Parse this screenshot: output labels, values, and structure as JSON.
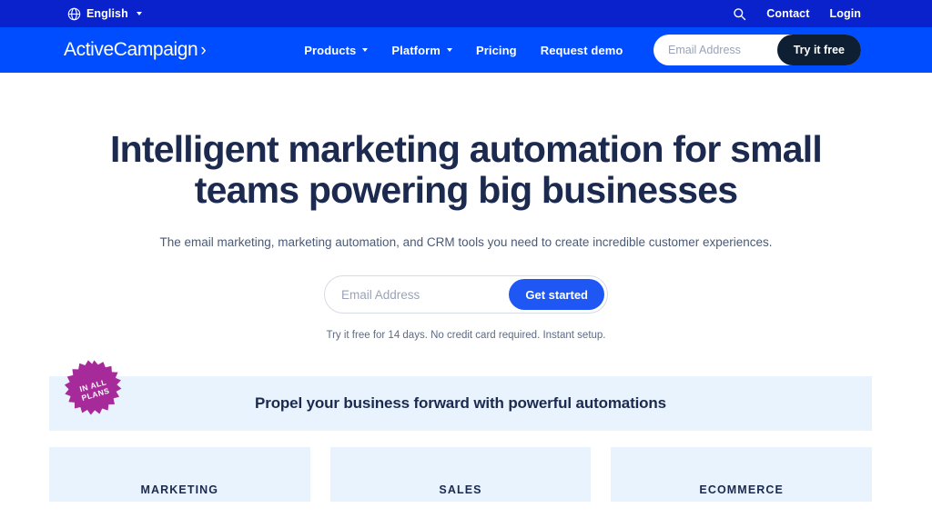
{
  "topbar": {
    "language": "English",
    "globe_icon": "globe-icon",
    "caret_icon": "chevron-down-icon",
    "search_icon": "search-icon",
    "links": [
      {
        "label": "Contact"
      },
      {
        "label": "Login"
      }
    ]
  },
  "navbar": {
    "logo_text": "ActiveCampaign",
    "logo_chevron": "›",
    "links": [
      {
        "label": "Products",
        "has_caret": true
      },
      {
        "label": "Platform",
        "has_caret": true
      },
      {
        "label": "Pricing",
        "has_caret": false
      },
      {
        "label": "Request demo",
        "has_caret": false
      }
    ],
    "email_placeholder": "Email Address",
    "email_value": "",
    "cta_label": "Try it free"
  },
  "hero": {
    "title": "Intelligent marketing automation for small teams powering big businesses",
    "subtitle": "The email marketing, marketing automation, and CRM tools you need to create incredible customer experiences.",
    "email_placeholder": "Email Address",
    "email_value": "",
    "cta_label": "Get started",
    "fineprint": "Try it free for 14 days. No credit card required. Instant setup."
  },
  "banner": {
    "title": "Propel your business forward with powerful automations",
    "badge": {
      "line1": "IN ALL",
      "line2": "PLANS",
      "color": "#A62A99"
    }
  },
  "cards": [
    {
      "label": "MARKETING"
    },
    {
      "label": "SALES"
    },
    {
      "label": "ECOMMERCE"
    }
  ],
  "colors": {
    "topbar_blue": "#0A22CC",
    "nav_blue": "#004CFF",
    "navy": "#1B2A4E",
    "cta_dark": "#0E1F33",
    "cta_blue": "#1F57F5",
    "panel_blue": "#E8F3FD",
    "badge_magenta": "#A62A99"
  }
}
